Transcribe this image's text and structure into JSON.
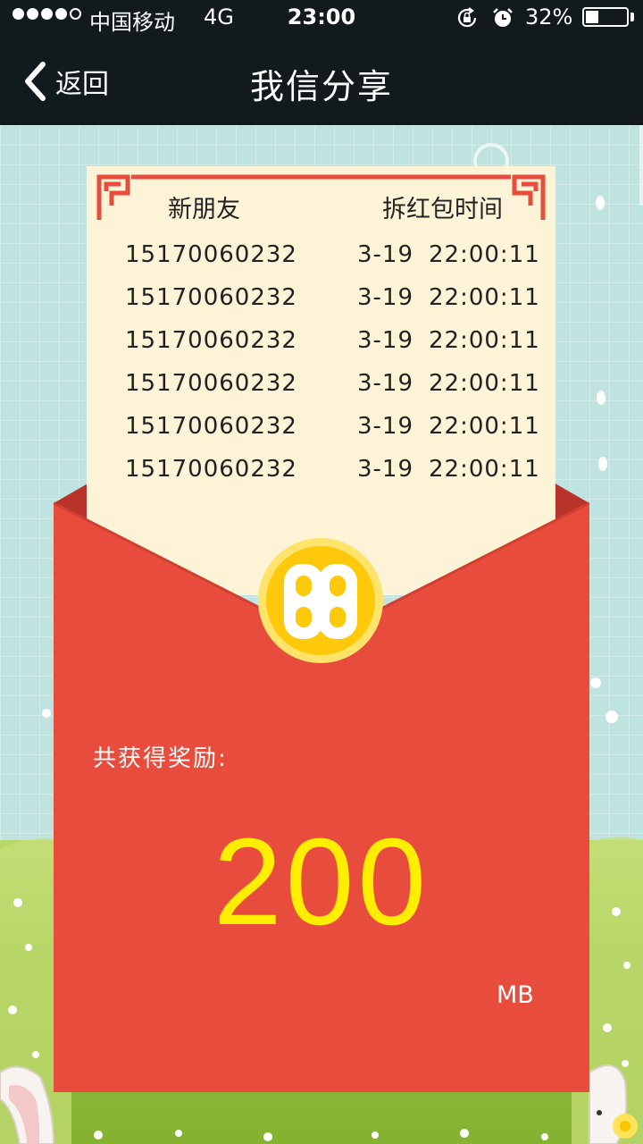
{
  "status_bar": {
    "carrier": "中国移动",
    "network": "4G",
    "time": "23:00",
    "battery": "32%",
    "battery_level": 0.32,
    "signal_bars_filled": 4,
    "signal_bars_total": 5,
    "icons": [
      "signal-icon",
      "rotation-lock-icon",
      "alarm-icon",
      "battery-icon"
    ]
  },
  "nav": {
    "back_label": "返回",
    "title": "我信分享"
  },
  "records": {
    "col_friend": "新朋友",
    "col_time": "拆红包时间",
    "rows": [
      {
        "phone": "15170060232",
        "date": "3-19",
        "time": "22:00:11"
      },
      {
        "phone": "15170060232",
        "date": "3-19",
        "time": "22:00:11"
      },
      {
        "phone": "15170060232",
        "date": "3-19",
        "time": "22:00:11"
      },
      {
        "phone": "15170060232",
        "date": "3-19",
        "time": "22:00:11"
      },
      {
        "phone": "15170060232",
        "date": "3-19",
        "time": "22:00:11"
      },
      {
        "phone": "15170060232",
        "date": "3-19",
        "time": "22:00:11"
      }
    ]
  },
  "reward": {
    "label": "共获得奖励:",
    "amount": "200",
    "unit": "MB"
  },
  "colors": {
    "bar": "#121a1e",
    "envelope_red": "#e84c3d",
    "envelope_dark": "#b8342a",
    "card": "#fdf4d8",
    "coin": "#fdc90a",
    "amount": "#ffee00",
    "sky": "#bfe4df"
  }
}
